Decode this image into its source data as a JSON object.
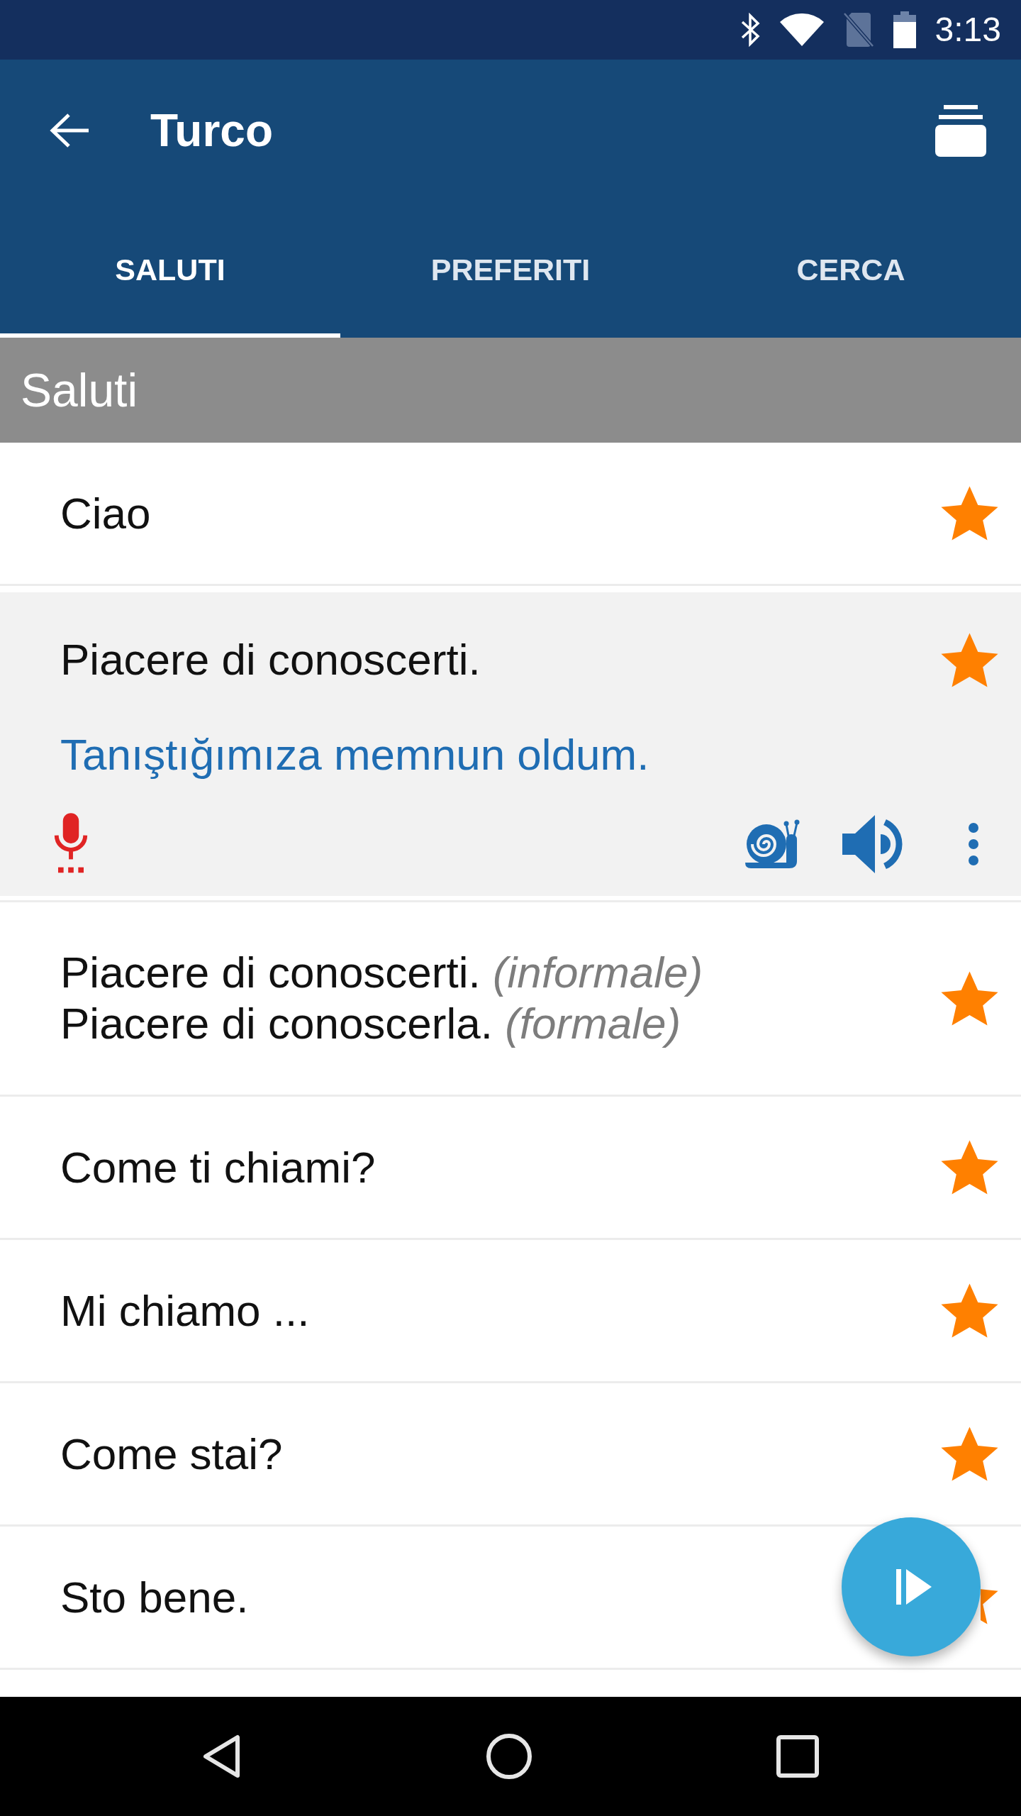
{
  "status_bar": {
    "time": "3:13"
  },
  "app_bar": {
    "title": "Turco"
  },
  "tabs": [
    {
      "label": "SALUTI",
      "selected": true
    },
    {
      "label": "PREFERITI",
      "selected": false
    },
    {
      "label": "CERCA",
      "selected": false
    }
  ],
  "section": {
    "title": "Saluti"
  },
  "phrases": [
    {
      "lines": [
        "Ciao"
      ],
      "favorite": true,
      "expanded": false
    },
    {
      "lines": [
        "Piacere di conoscerti."
      ],
      "translation": "Tanıştığımıza memnun oldum.",
      "favorite": true,
      "expanded": true
    },
    {
      "lines": [
        "Piacere di conoscerti. *(informale)*",
        "Piacere di conoscerla. *(formale)*"
      ],
      "favorite": true,
      "expanded": false
    },
    {
      "lines": [
        "Come ti chiami?"
      ],
      "favorite": true,
      "expanded": false
    },
    {
      "lines": [
        "Mi chiamo ..."
      ],
      "favorite": true,
      "expanded": false
    },
    {
      "lines": [
        "Come stai?"
      ],
      "favorite": true,
      "expanded": false
    },
    {
      "lines": [
        "Sto bene."
      ],
      "favorite": true,
      "expanded": false
    }
  ]
}
